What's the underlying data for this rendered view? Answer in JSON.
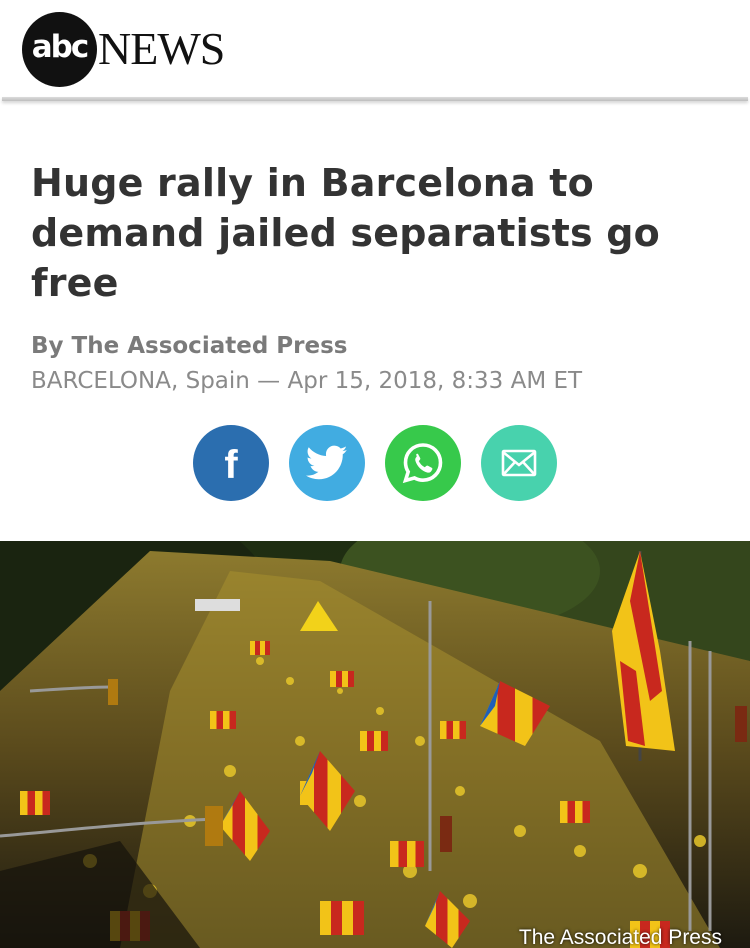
{
  "header": {
    "logo_abc": "abc",
    "logo_news": "NEWS"
  },
  "article": {
    "headline": "Huge rally in Barcelona to demand jailed separatists go free",
    "byline": "By The Associated Press",
    "dateline": "BARCELONA, Spain — Apr 15, 2018, 8:33 AM ET"
  },
  "share": [
    {
      "name": "facebook",
      "icon": "facebook-icon",
      "color": "#2b6eaf"
    },
    {
      "name": "twitter",
      "icon": "twitter-icon",
      "color": "#41ace1"
    },
    {
      "name": "whatsapp",
      "icon": "whatsapp-icon",
      "color": "#37c94b"
    },
    {
      "name": "email",
      "icon": "email-icon",
      "color": "#48d2ad"
    }
  ],
  "photo": {
    "description_icon": "crowd-photo",
    "credit": "The Associated Press"
  },
  "colors": {
    "flag_yellow": "#f2c318",
    "flag_red": "#c8281e",
    "estelada_blue": "#1f5fb8"
  }
}
